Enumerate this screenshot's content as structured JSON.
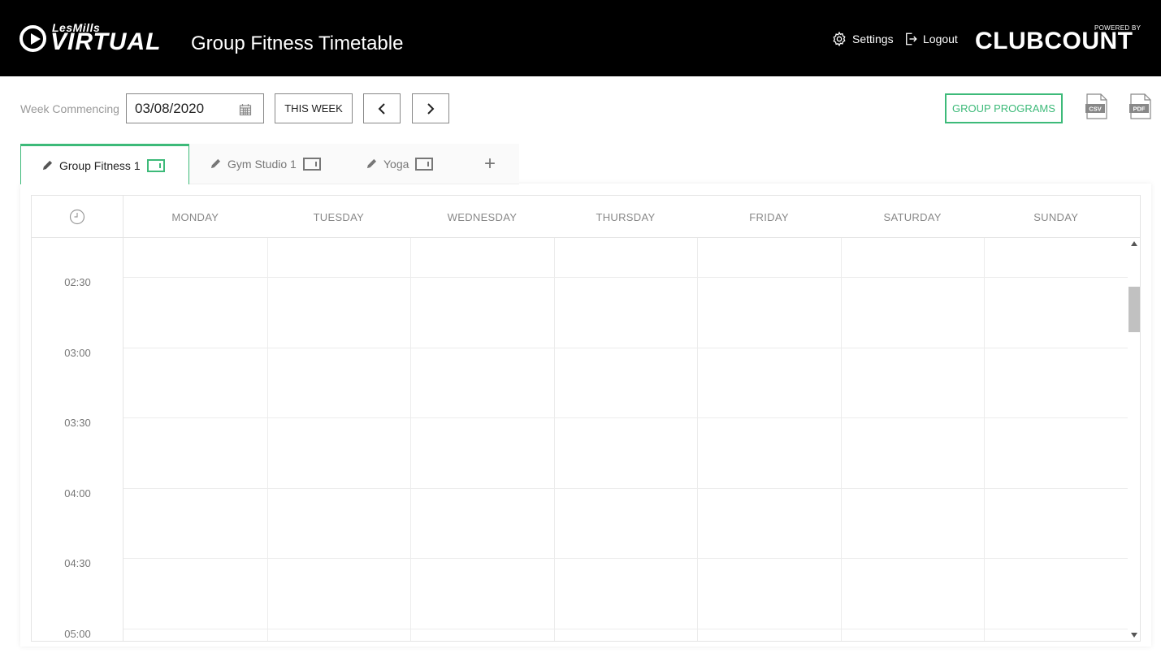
{
  "header": {
    "brand_top": "LesMills",
    "brand_main": "VIRTUAL",
    "title": "Group Fitness Timetable",
    "settings_label": "Settings",
    "logout_label": "Logout",
    "powered_by": "POWERED BY",
    "partner_logo": "CLUBCOUNT"
  },
  "toolbar": {
    "week_label": "Week Commencing",
    "week_value": "03/08/2020",
    "this_week_label": "THIS WEEK",
    "group_programs_label": "GROUP PROGRAMS",
    "csv_label": "CSV",
    "pdf_label": "PDF"
  },
  "tabs": [
    {
      "label": "Group Fitness 1",
      "active": true
    },
    {
      "label": "Gym Studio 1",
      "active": false
    },
    {
      "label": "Yoga",
      "active": false
    }
  ],
  "add_tab_label": "+",
  "calendar": {
    "days": [
      "MONDAY",
      "TUESDAY",
      "WEDNESDAY",
      "THURSDAY",
      "FRIDAY",
      "SATURDAY",
      "SUNDAY"
    ],
    "times": [
      "02:30",
      "03:00",
      "03:30",
      "04:00",
      "04:30",
      "05:00"
    ]
  },
  "colors": {
    "accent": "#3dba79",
    "header_bg": "#000000"
  }
}
